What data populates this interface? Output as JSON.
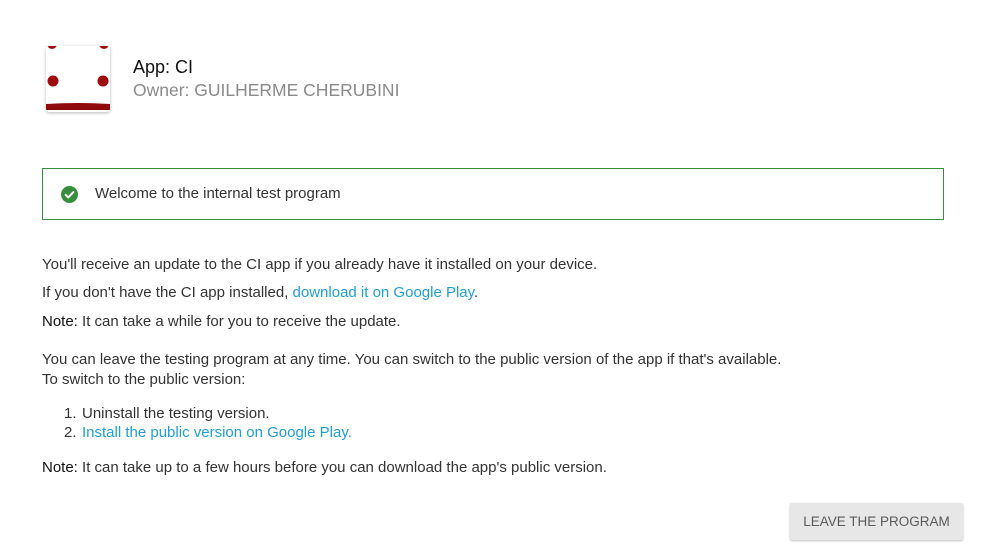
{
  "app": {
    "title": "App: CI",
    "owner": "Owner: GUILHERME CHERUBINI",
    "icon": "app-icon"
  },
  "banner": {
    "icon": "check-circle-icon",
    "text": "Welcome to the internal test program"
  },
  "body": {
    "update_info": "You'll receive an update to the CI app if you already have it installed on your device.",
    "install_prefix": "If you don't have the CI app installed, ",
    "install_link": "download it on Google Play",
    "install_suffix": ".",
    "note1_label": "Note:",
    "note1_text": " It can take a while for you to receive the update.",
    "leave_info": "You can leave the testing program at any time. You can switch to the public version of the app if that's available.",
    "switch_intro": "To switch to the public version:",
    "steps": [
      {
        "num": "1.",
        "text": "Uninstall the testing version."
      },
      {
        "num": "2.",
        "text": "Install the public version on Google Play."
      }
    ],
    "note2_label": "Note:",
    "note2_text": " It can take up to a few hours before you can download the app's public version."
  },
  "button": {
    "label": "LEAVE THE PROGRAM"
  },
  "colors": {
    "text": "#333333",
    "link": "#1e9fd8",
    "success": "#388e3c",
    "icon_red": "#a00d0d",
    "button_bg": "#e7e7e7"
  }
}
